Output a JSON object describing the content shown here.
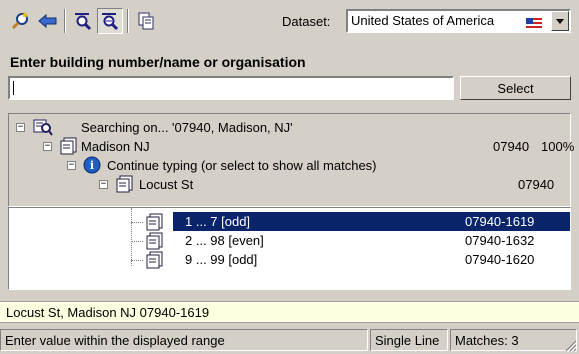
{
  "toolbar": {
    "icons": [
      "search-icon",
      "back-arrow-icon",
      "filter-icon",
      "filter-active-icon",
      "copy-icon"
    ],
    "dataset_label": "Dataset:",
    "dataset_value": "United States of America"
  },
  "entry": {
    "heading": "Enter building number/name or organisation",
    "value": "",
    "select_label": "Select"
  },
  "tree": {
    "searching": "Searching on... '07940, Madison, NJ'",
    "locality": {
      "label": "Madison NJ",
      "code": "07940",
      "percent": "100%"
    },
    "hint": "Continue typing (or select to show all matches)",
    "street": {
      "label": "Locust St",
      "code": "07940"
    },
    "ranges": [
      {
        "label": "1 ... 7  [odd]",
        "code": "07940-1619",
        "selected": true
      },
      {
        "label": "2 ... 98  [even]",
        "code": "07940-1632",
        "selected": false
      },
      {
        "label": "9 ... 99  [odd]",
        "code": "07940-1620",
        "selected": false
      }
    ]
  },
  "address_preview": "Locust St, Madison NJ  07940-1619",
  "status": {
    "message": "Enter value within the displayed range",
    "mode": "Single Line",
    "matches": "Matches: 3"
  },
  "colors": {
    "selection": "#0a246a",
    "panel": "#d4d0c8",
    "preview_bg": "#ffffe1",
    "info": "#1f5fc0"
  }
}
